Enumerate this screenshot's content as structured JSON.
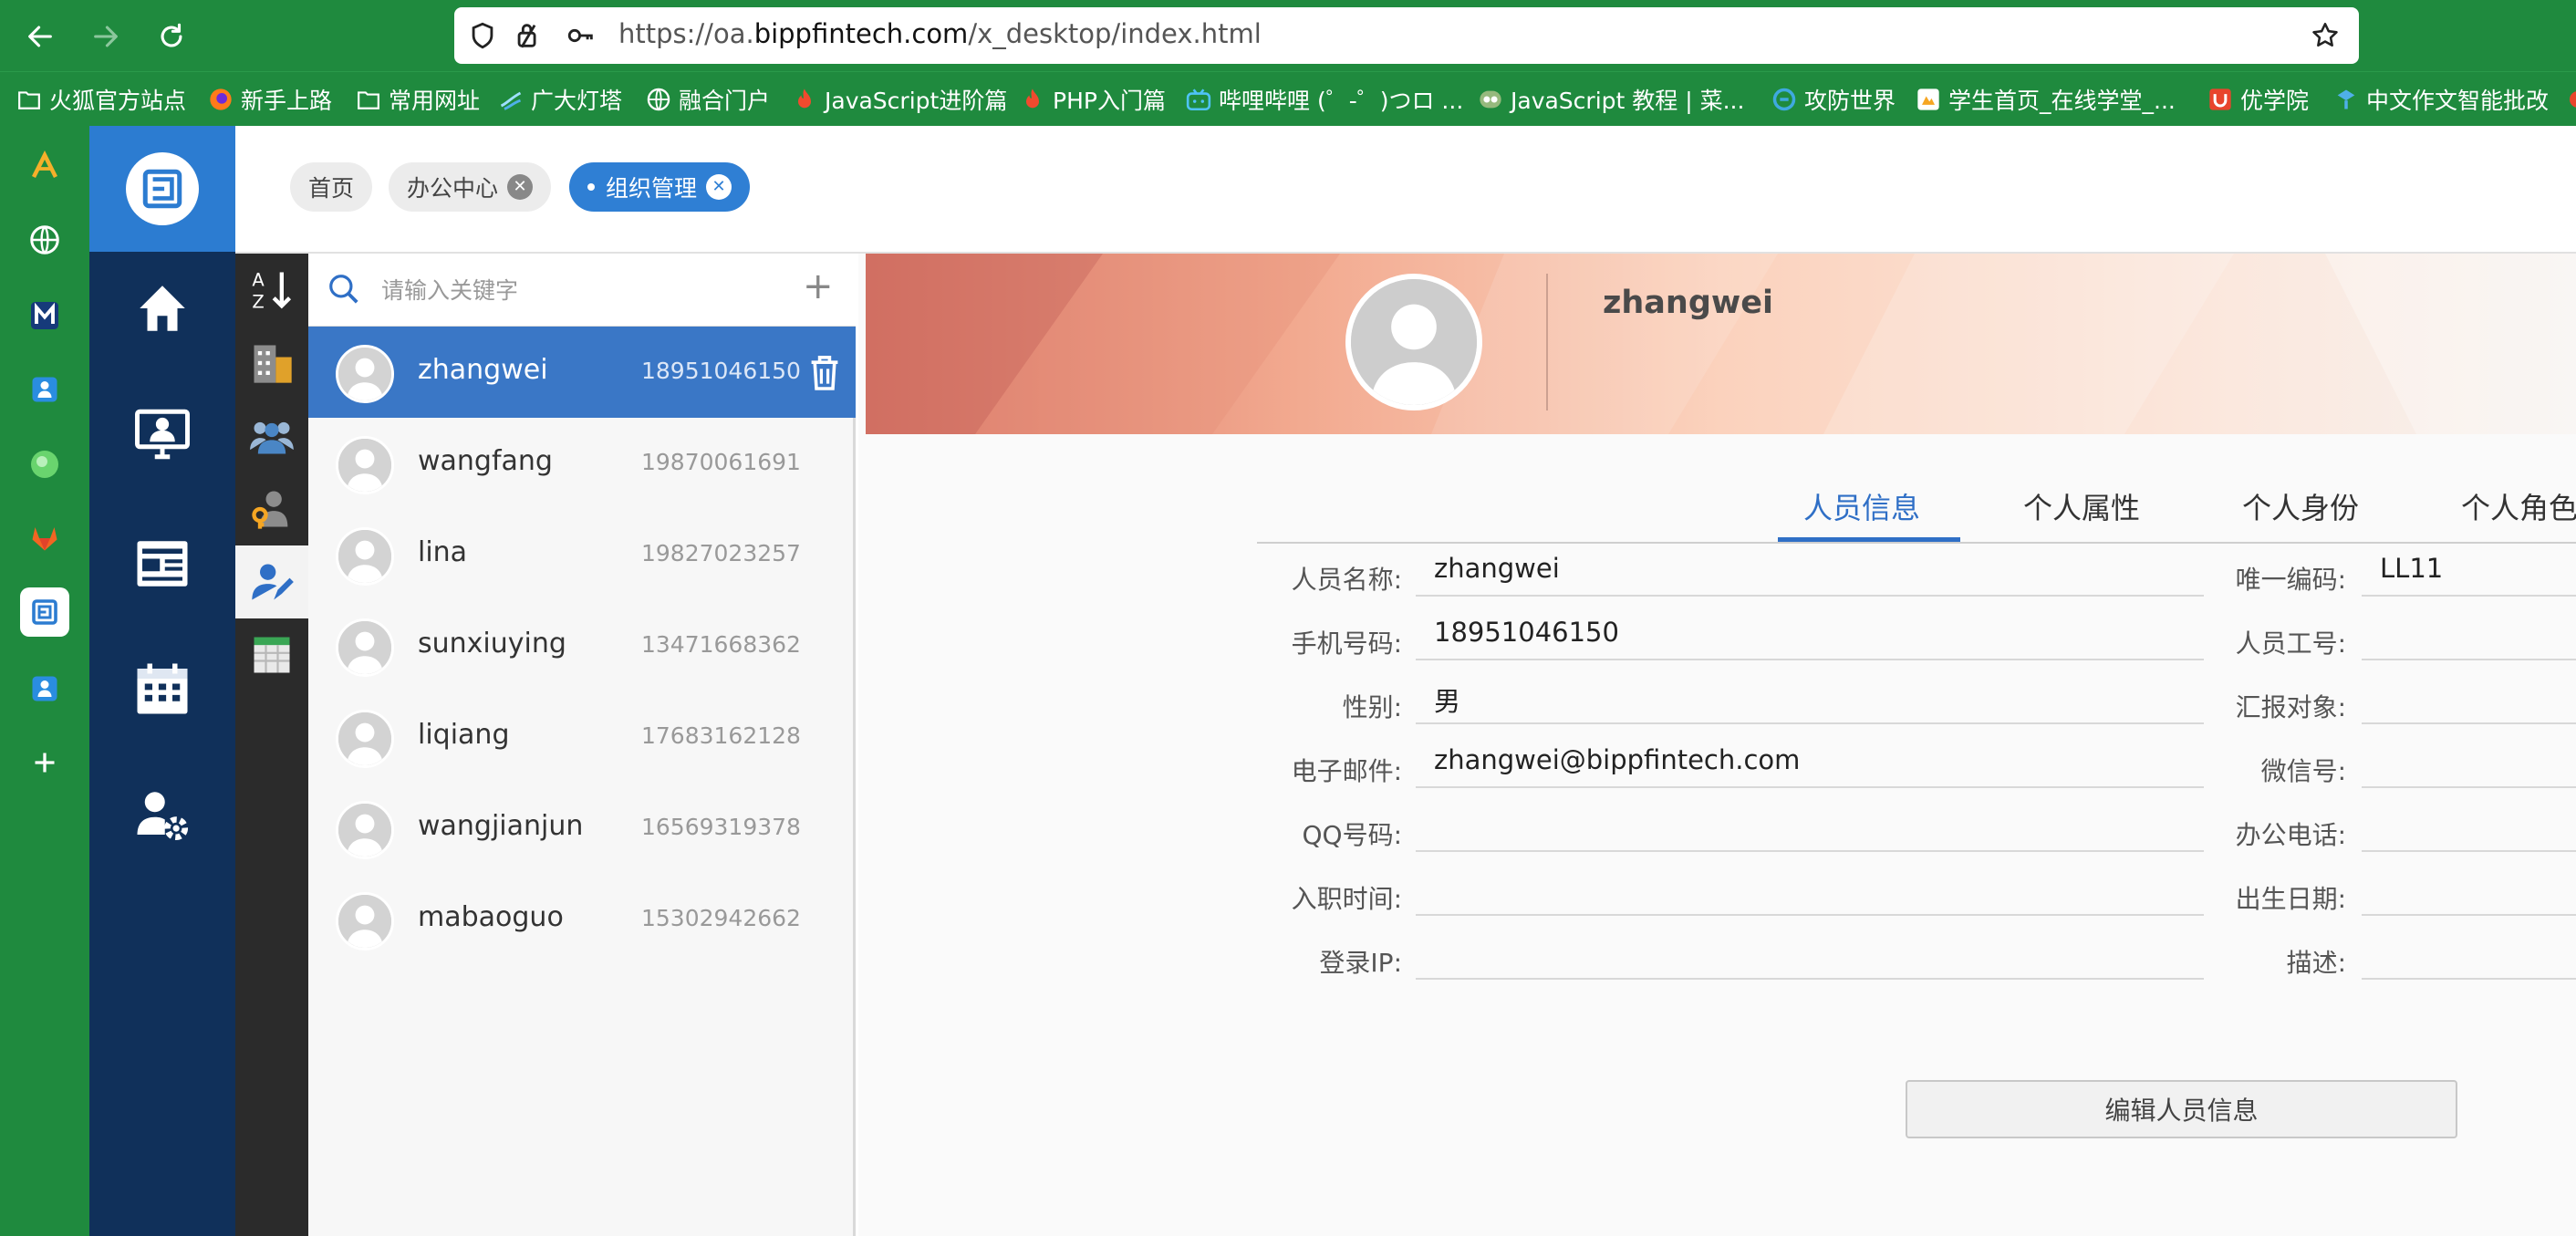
{
  "browser": {
    "url": {
      "prefix": "https://oa.",
      "domain": "bippfintech.com",
      "path": "/x_desktop/index.html"
    },
    "bookmarks": [
      {
        "icon": "folder-icon",
        "label": "火狐官方站点"
      },
      {
        "icon": "firefox-icon",
        "label": "新手上路"
      },
      {
        "icon": "folder-icon",
        "label": "常用网址"
      },
      {
        "icon": "lighthouse-icon",
        "label": "广大灯塔"
      },
      {
        "icon": "globe-icon",
        "label": "融合门户"
      },
      {
        "icon": "flame-icon",
        "label": "JavaScript进阶篇"
      },
      {
        "icon": "flame-icon",
        "label": "PHP入门篇"
      },
      {
        "icon": "bilibili-icon",
        "label": "哔哩哔哩 (゜-゜)つロ ..."
      },
      {
        "icon": "runoob-icon",
        "label": "JavaScript 教程 | 菜..."
      },
      {
        "icon": "adworld-icon",
        "label": "攻防世界"
      },
      {
        "icon": "school-icon",
        "label": "学生首页_在线学堂_..."
      },
      {
        "icon": "youxueyuan-icon",
        "label": "优学院"
      },
      {
        "icon": "writing-icon",
        "label": "中文作文智能批改"
      }
    ],
    "sidebar_icons": [
      "aiding-icon",
      "globe-icon",
      "m-icon",
      "person-blue-icon",
      "green-circle-icon",
      "gitlab-icon",
      "oa-app-icon",
      "person-blue-icon",
      "add-icon"
    ]
  },
  "app": {
    "nav": [
      "home-icon",
      "desktop-user-icon",
      "news-icon",
      "calendar-icon",
      "user-settings-icon"
    ],
    "tabs": [
      {
        "label": "首页",
        "closable": false,
        "active": false
      },
      {
        "label": "办公中心",
        "closable": true,
        "active": false
      },
      {
        "label": "组织管理",
        "closable": true,
        "active": true
      }
    ],
    "tools": [
      "sort-az-icon",
      "building-icon",
      "group-icon",
      "person-key-icon",
      "person-edit-icon",
      "sheet-icon"
    ],
    "search": {
      "placeholder": "请输入关键字"
    },
    "users": [
      {
        "name": "zhangwei",
        "phone": "18951046150"
      },
      {
        "name": "wangfang",
        "phone": "19870061691"
      },
      {
        "name": "lina",
        "phone": "19827023257"
      },
      {
        "name": "sunxiuying",
        "phone": "13471668362"
      },
      {
        "name": "liqiang",
        "phone": "17683162128"
      },
      {
        "name": "wangjianjun",
        "phone": "16569319378"
      },
      {
        "name": "mabaoguo",
        "phone": "15302942662"
      }
    ],
    "detail": {
      "name": "zhangwei",
      "tabs": [
        "人员信息",
        "个人属性",
        "个人身份",
        "个人角色"
      ],
      "left_fields": [
        {
          "label": "人员名称:",
          "value": "zhangwei"
        },
        {
          "label": "手机号码:",
          "value": "18951046150"
        },
        {
          "label": "性别:",
          "value": "男"
        },
        {
          "label": "电子邮件:",
          "value": "zhangwei@bippfintech.com"
        },
        {
          "label": "QQ号码:",
          "value": ""
        },
        {
          "label": "入职时间:",
          "value": ""
        },
        {
          "label": "登录IP:",
          "value": ""
        }
      ],
      "right_fields": [
        {
          "label": "唯一编码:",
          "value": "LL11"
        },
        {
          "label": "人员工号:",
          "value": ""
        },
        {
          "label": "汇报对象:",
          "value": ""
        },
        {
          "label": "微信号:",
          "value": ""
        },
        {
          "label": "办公电话:",
          "value": ""
        },
        {
          "label": "出生日期:",
          "value": ""
        },
        {
          "label": "描述:",
          "value": ""
        }
      ],
      "edit_button": "编辑人员信息"
    }
  },
  "colors": {
    "browser_green": "#1f8a3e",
    "app_nav": "#10305a",
    "accent_blue": "#2f7fd4",
    "selected_row": "#3a77c6"
  }
}
